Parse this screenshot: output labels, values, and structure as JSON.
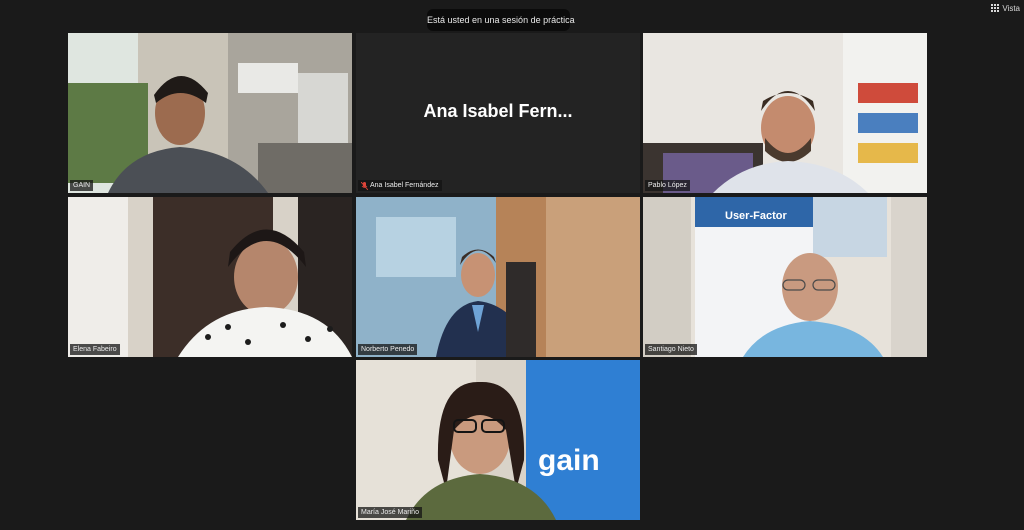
{
  "banner": {
    "practice_text": "Está usted en una sesión de práctica"
  },
  "toolbar": {
    "view_label": "Vista",
    "view_icon": "grid-icon"
  },
  "colors": {
    "background": "#1a1a1a",
    "active_speaker_border": "#d9e05a"
  },
  "participants": [
    {
      "name": "GAIN",
      "video": true,
      "active_speaker": true
    },
    {
      "name": "Ana Isabel Fernández",
      "display_name": "Ana Isabel Fern...",
      "video": false,
      "muted": true
    },
    {
      "name": "Pablo López",
      "video": true
    },
    {
      "name": "Elena Fabeiro",
      "video": true
    },
    {
      "name": "Norberto Penedo",
      "video": true
    },
    {
      "name": "Santiago Nieto",
      "video": true,
      "banner_title": "User-Factor"
    },
    {
      "name": "María José Mariño",
      "video": true,
      "backdrop_text": "gain"
    }
  ]
}
